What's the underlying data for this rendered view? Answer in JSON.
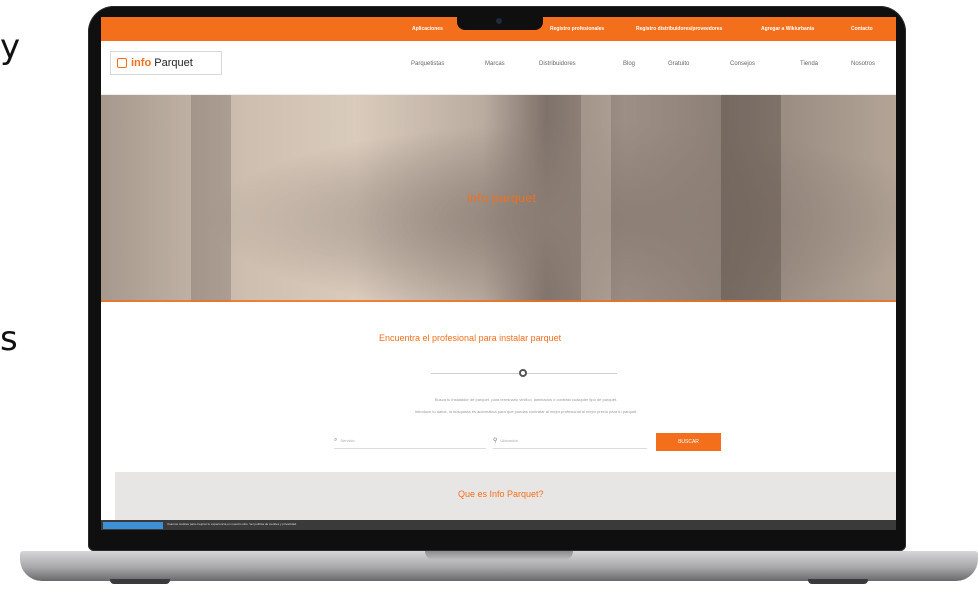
{
  "colors": {
    "accent": "#f36f1b",
    "lid": "#0f0f10",
    "about_bg": "#e8e6e5"
  },
  "side": {
    "glyph_top": "y",
    "glyph_bottom": "s"
  },
  "topbar": {
    "links": [
      "Aplicaciones",
      "Registro profesionales",
      "Registro distribuidores/proveedores",
      "Agregar a Wikiurbanía",
      "Contacto"
    ]
  },
  "brand": {
    "logo_prefix": "info",
    "logo_suffix": "Parquet"
  },
  "nav": {
    "items": [
      "Parquetistas",
      "Marcas",
      "Distribuidores",
      "Blog",
      "Gratuito",
      "Consejos",
      "Tienda",
      "Nosotros"
    ]
  },
  "hero": {
    "title": "info parquet"
  },
  "find": {
    "title": "Encuentra el profesional para instalar parquet",
    "desc_line1": "Busca tu instalador de parquet, para terminarlo vinílico, laminados o contrato cualquier tipo de parquet.",
    "desc_line2": "Introduce tu datos, la búsqueda es automática para que puedas contratar al mejor profesional al mejor precio para tu parquet.",
    "field_service_placeholder": "Servicio",
    "field_location_placeholder": "Ubicación",
    "search_label": "BUSCAR"
  },
  "about": {
    "title": "Que es Info Parquet?"
  },
  "cookie": {
    "text": "Usamos cookies para mejorar tu experiencia en nuestro sitio. Ver política de cookies y privacidad."
  },
  "icons": {
    "service": "search-icon",
    "location": "map-pin-icon"
  }
}
